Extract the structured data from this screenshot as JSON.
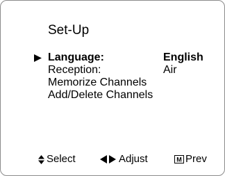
{
  "menu": {
    "title": "Set-Up",
    "items": [
      {
        "label": "Language:",
        "value": "English",
        "selected": true
      },
      {
        "label": "Reception:",
        "value": "Air",
        "selected": false
      },
      {
        "label": "Memorize Channels",
        "value": "",
        "selected": false
      },
      {
        "label": "Add/Delete Channels",
        "value": "",
        "selected": false
      }
    ]
  },
  "footer": {
    "select": {
      "icon": "up-down-arrows-icon",
      "label": "Select"
    },
    "adjust": {
      "icon": "left-right-arrows-icon",
      "label": "Adjust"
    },
    "prev": {
      "icon": "menu-button-icon",
      "icon_text": "M",
      "label": "Prev"
    }
  },
  "cursor_icon": "play-triangle-icon"
}
